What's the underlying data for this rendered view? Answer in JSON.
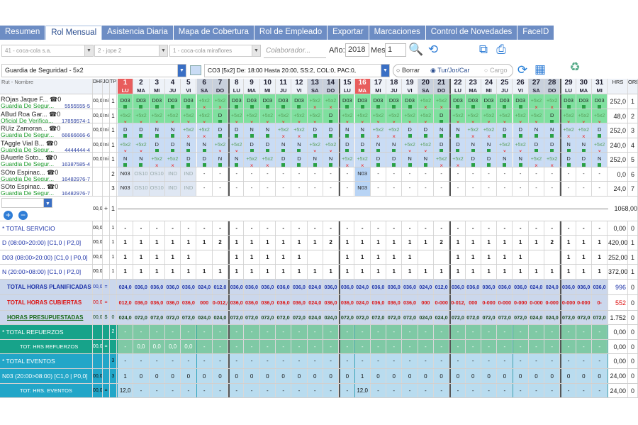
{
  "tabs": [
    "Resumen",
    "Rol Mensual",
    "Asistencia Diaria",
    "Mapa de Cobertura",
    "Rol de Empleado",
    "Exportar",
    "Marcaciones",
    "Control de Novedades",
    "FaceID"
  ],
  "active_tab": 1,
  "filters": {
    "company": "41 - coca-cola s.a.",
    "boss": "2 - jope 2",
    "branch": "1 - coca-cola miraflores",
    "collaborator_placeholder": "Colaborador...",
    "year_label": "Año:",
    "year": "2018",
    "month_label": "Mes:",
    "month": "1"
  },
  "service": {
    "name": "Guardia de Seguridad - 5x2",
    "code_text": "CO3    [5x2] De: 18:00 Hasta 20:00, SS:2, COL:0, PAC:0,",
    "radio_borrar": "Borrar",
    "radio_tur": "Tur/Jor/Car",
    "radio_cargo": "Cargo"
  },
  "colors": {
    "accent": "#6d8dc4",
    "red_day": "#e85d5d",
    "green_row": "#7fe09f",
    "blue_row": "#c9dcf5",
    "teal": "#17a38a",
    "cyan": "#22a6c8"
  },
  "header": {
    "rut_label": "Rut - Nombre",
    "dhp": "DHP",
    "jo": "JO",
    "tp": "TP",
    "hrs": "HRS",
    "ord": "ORD"
  },
  "days": [
    {
      "n": "1",
      "d": "LU"
    },
    {
      "n": "2",
      "d": "MA"
    },
    {
      "n": "3",
      "d": "MI"
    },
    {
      "n": "4",
      "d": "JU"
    },
    {
      "n": "5",
      "d": "VI"
    },
    {
      "n": "6",
      "d": "SA"
    },
    {
      "n": "7",
      "d": "DO"
    },
    {
      "n": "8",
      "d": "LU"
    },
    {
      "n": "9",
      "d": "MA"
    },
    {
      "n": "10",
      "d": "MI"
    },
    {
      "n": "11",
      "d": "JU"
    },
    {
      "n": "12",
      "d": "VI"
    },
    {
      "n": "13",
      "d": "SA"
    },
    {
      "n": "14",
      "d": "DO"
    },
    {
      "n": "15",
      "d": "LU"
    },
    {
      "n": "16",
      "d": "MA"
    },
    {
      "n": "17",
      "d": "MI"
    },
    {
      "n": "18",
      "d": "JU"
    },
    {
      "n": "19",
      "d": "VI"
    },
    {
      "n": "20",
      "d": "SA"
    },
    {
      "n": "21",
      "d": "DO"
    },
    {
      "n": "22",
      "d": "LU"
    },
    {
      "n": "23",
      "d": "MA"
    },
    {
      "n": "24",
      "d": "MI"
    },
    {
      "n": "25",
      "d": "JU"
    },
    {
      "n": "26",
      "d": "VI"
    },
    {
      "n": "27",
      "d": "SA"
    },
    {
      "n": "28",
      "d": "DO"
    },
    {
      "n": "29",
      "d": "LU"
    },
    {
      "n": "30",
      "d": "MA"
    },
    {
      "n": "31",
      "d": "MI"
    }
  ],
  "employees": [
    {
      "name": "ROjas Jaque F...",
      "role": "Guardia De Segur...",
      "rut": "5555555-5",
      "dhp": "00,0",
      "jo": "Ini",
      "tp": "1",
      "hrs": "252,0",
      "ord": "1",
      "color": "green",
      "cells": [
        "D03",
        "D03",
        "D03",
        "D03",
        "D03",
        "+5x2",
        "+5x2",
        "D03",
        "D03",
        "D03",
        "D03",
        "D03",
        "+5x2",
        "+5x2",
        "D03",
        "D03",
        "D03",
        "D03",
        "D03",
        "+5x2",
        "+5x2",
        "D03",
        "D03",
        "D03",
        "D03",
        "D03",
        "+5x2",
        "+5x2",
        "D03",
        "D03",
        "D03"
      ]
    },
    {
      "name": "ABud Roa Gar...",
      "role": "Oficial De Verifica...",
      "rut": "17859574-1",
      "dhp": "00,0",
      "jo": "Ini",
      "tp": "1",
      "hrs": "48,0",
      "ord": "2",
      "color": "green",
      "cells": [
        "+5x2",
        "+5x2",
        "+5x2",
        "+5x2",
        "+5x2",
        "+5x2",
        "D",
        "+5x2",
        "+5x2",
        "+5x2",
        "+5x2",
        "+5x2",
        "+5x2",
        "D",
        "+5x2",
        "+5x2",
        "+5x2",
        "+5x2",
        "+5x2",
        "+5x2",
        "D",
        "+5x2",
        "+5x2",
        "+5x2",
        "+5x2",
        "+5x2",
        "+5x2",
        "D",
        "+5x2",
        "+5x2",
        "+5x2"
      ]
    },
    {
      "name": "RUiz Zamoran...",
      "role": "Guardia De Segur...",
      "rut": "66666666-6",
      "dhp": "00,0",
      "jo": "Ini",
      "tp": "1",
      "hrs": "252,0",
      "ord": "3",
      "color": "blue",
      "cells": [
        "D",
        "D",
        "N",
        "N",
        "+5x2",
        "+5x2",
        "D",
        "D",
        "N",
        "N",
        "+5x2",
        "+5x2",
        "D",
        "D",
        "N",
        "N",
        "+5x2",
        "+5x2",
        "D",
        "D",
        "N",
        "N",
        "+5x2",
        "+5x2",
        "D",
        "D",
        "N",
        "N",
        "+5x2",
        "+5x2",
        "D"
      ]
    },
    {
      "name": "TAggle Vial B...",
      "role": "Guardia De Segur...",
      "rut": "4444444-4",
      "dhp": "00,0",
      "jo": "Ini",
      "tp": "1",
      "hrs": "240,0",
      "ord": "4",
      "color": "blue",
      "cells": [
        "+5x2",
        "+5x2",
        "D",
        "D",
        "N",
        "N",
        "+5x2",
        "+5x2",
        "D",
        "D",
        "N",
        "N",
        "+5x2",
        "+5x2",
        "D",
        "D",
        "N",
        "N",
        "+5x2",
        "+5x2",
        "D",
        "D",
        "N",
        "N",
        "+5x2",
        "+5x2",
        "D",
        "D",
        "N",
        "N",
        "+5x2"
      ]
    },
    {
      "name": "BAuerle Soto...",
      "role": "Guardia De Segur...",
      "rut": "16387585-4",
      "dhp": "00,0",
      "jo": "Ini",
      "tp": "1",
      "hrs": "252,0",
      "ord": "5",
      "color": "blue",
      "cells": [
        "N",
        "N",
        "+5x2",
        "+5x2",
        "D",
        "D",
        "N",
        "N",
        "+5x2",
        "+5x2",
        "D",
        "D",
        "N",
        "N",
        "+5x2",
        "+5x2",
        "D",
        "D",
        "N",
        "N",
        "+5x2",
        "+5x2",
        "D",
        "D",
        "N",
        "N",
        "+5x2",
        "+5x2",
        "D",
        "D",
        "N"
      ]
    },
    {
      "name": "SOto Espinac...",
      "role": "Guardia De Segur...",
      "rut": "16482976-7",
      "dhp": "",
      "jo": "",
      "tp": "2",
      "hrs": "0,0",
      "ord": "6",
      "color": "white",
      "cells": [
        "N03",
        "OS10",
        "OS10",
        "IND",
        "IND",
        "-",
        "-",
        "-",
        "-",
        "-",
        "-",
        "-",
        "-",
        "-",
        "-",
        "N03",
        "-",
        "-",
        "-",
        "-",
        "-",
        "-",
        "-",
        "-",
        "-",
        "-",
        "-",
        "-",
        "-",
        "-",
        "-"
      ]
    },
    {
      "name": "SOto Espinac...",
      "role": "Guardia De Segur...",
      "rut": "16482976-7",
      "dhp": "",
      "jo": "",
      "tp": "3",
      "hrs": "24,0",
      "ord": "7",
      "color": "white",
      "cells": [
        "N03",
        "OS10",
        "OS10",
        "IND",
        "IND",
        "-",
        "-",
        "-",
        "-",
        "-",
        "-",
        "-",
        "-",
        "-",
        "-",
        "N03",
        "-",
        "-",
        "-",
        "-",
        "-",
        "-",
        "-",
        "-",
        "-",
        "-",
        "-",
        "-",
        "-",
        "-",
        "-"
      ]
    }
  ],
  "blank_row": {
    "dhp": "00,0",
    "jo": "+",
    "tp": "1",
    "hrs": "1068,00",
    "ord": "0"
  },
  "summary": [
    {
      "label": "* TOTAL SERVICIO",
      "dhp": "00,0",
      "jo": "",
      "tp": "1",
      "vals": "-",
      "hrs": "0,00",
      "ord": "0",
      "style": "plain"
    },
    {
      "label": "D (08:00>20:00) [C1,0 | P2,0]",
      "dhp": "00,0",
      "jo": "",
      "tp": "1",
      "vals": [
        "1",
        "1",
        "1",
        "1",
        "1",
        "1",
        "2",
        "1",
        "1",
        "1",
        "1",
        "1",
        "1",
        "2",
        "1",
        "1",
        "1",
        "1",
        "1",
        "1",
        "2",
        "1",
        "1",
        "1",
        "1",
        "1",
        "1",
        "2",
        "1",
        "1",
        "1"
      ],
      "hrs": "420,00",
      "ord": "1",
      "style": "plain"
    },
    {
      "label": "D03 (08:00>20:00) [C1,0 | P0,0]",
      "dhp": "00,0",
      "jo": "",
      "tp": "1",
      "vals": [
        "1",
        "1",
        "1",
        "1",
        "1",
        "",
        "",
        "1",
        "1",
        "1",
        "1",
        "1",
        "",
        "",
        "1",
        "1",
        "1",
        "1",
        "1",
        "",
        "",
        "1",
        "1",
        "1",
        "1",
        "1",
        "",
        "",
        "1",
        "1",
        "1"
      ],
      "hrs": "252,00",
      "ord": "1",
      "style": "plain"
    },
    {
      "label": "N (20:00>08:00) [C1,0 | P2,0]",
      "dhp": "00,0",
      "jo": "",
      "tp": "1",
      "vals": [
        "1",
        "1",
        "1",
        "1",
        "1",
        "1",
        "1",
        "1",
        "1",
        "1",
        "1",
        "1",
        "1",
        "1",
        "1",
        "1",
        "1",
        "1",
        "1",
        "1",
        "1",
        "1",
        "1",
        "1",
        "1",
        "1",
        "1",
        "1",
        "1",
        "1",
        "1"
      ],
      "hrs": "372,00",
      "ord": "1",
      "style": "plain"
    },
    {
      "label": "TOTAL HORAS PLANIFICADAS",
      "dhp": "00,0",
      "jo": "=",
      "tp": "",
      "vals": [
        "024,0",
        "036,0",
        "036,0",
        "036,0",
        "036,0",
        "024,0",
        "012,0",
        "036,0",
        "036,0",
        "036,0",
        "036,0",
        "036,0",
        "024,0",
        "036,0",
        "036,0",
        "024,0",
        "036,0",
        "036,0",
        "036,0",
        "024,0",
        "012,0",
        "036,0",
        "036,0",
        "036,0",
        "036,0",
        "036,0",
        "024,0",
        "024,0",
        "036,0",
        "036,0",
        "036,0"
      ],
      "hrs": "996",
      "ord": "0",
      "style": "blue"
    },
    {
      "label": "TOTAL HORAS CUBIERTAS",
      "dhp": "00,0",
      "jo": "=",
      "tp": "",
      "vals": [
        "012,0",
        "036,0",
        "036,0",
        "036,0",
        "036,0",
        "000",
        "0-012,0",
        "036,0",
        "036,0",
        "036,0",
        "036,0",
        "036,0",
        "024,0",
        "036,0",
        "036,0",
        "024,0",
        "036,0",
        "036,0",
        "036,0",
        "000",
        "0-000",
        "0-012,0",
        "000",
        "0-000",
        "0-000",
        "0-000",
        "0-000",
        "0-000",
        "0-000",
        "0-000",
        "0-"
      ],
      "hrs": "552",
      "ord": "0",
      "style": "red"
    },
    {
      "label": "HORAS PRESUPUESTADAS",
      "dhp": "00,0",
      "jo": "$",
      "tp": "0",
      "vals": [
        "024,0",
        "072,0",
        "072,0",
        "072,0",
        "072,0",
        "024,0",
        "024,0",
        "072,0",
        "072,0",
        "072,0",
        "072,0",
        "072,0",
        "024,0",
        "024,0",
        "072,0",
        "072,0",
        "072,0",
        "072,0",
        "072,0",
        "024,0",
        "024,0",
        "072,0",
        "072,0",
        "072,0",
        "072,0",
        "072,0",
        "024,0",
        "024,0",
        "072,0",
        "072,0",
        "072,0"
      ],
      "hrs": "1.752",
      "ord": "0",
      "style": "green"
    },
    {
      "label": "* TOTAL REFUERZOS",
      "dhp": "",
      "jo": "",
      "tp": "2",
      "vals": "-",
      "hrs": "0,00",
      "ord": "0",
      "style": "teal"
    },
    {
      "label": "TOT. HRS REFUERZOS",
      "dhp": "00,0",
      "jo": "=",
      "tp": "",
      "vals": [
        "-",
        "0,0",
        "0,0",
        "0,0",
        "0,0",
        "-",
        "-",
        "-",
        "-",
        "-",
        "-",
        "-",
        "-",
        "-",
        "-",
        "-",
        "-",
        "-",
        "-",
        "-",
        "-",
        "-",
        "-",
        "-",
        "-",
        "-",
        "-",
        "-",
        "-",
        "-",
        "-"
      ],
      "hrs": "0,00",
      "ord": "0",
      "style": "teal"
    },
    {
      "label": "* TOTAL EVENTOS",
      "dhp": "",
      "jo": "",
      "tp": "3",
      "vals": "-",
      "hrs": "0,00",
      "ord": "0",
      "style": "cyan"
    },
    {
      "label": "N03 (20:00>08:00) [C1,0 | P0,0]",
      "dhp": "00,0",
      "jo": "",
      "tp": "3",
      "vals": [
        "1",
        "0",
        "0",
        "0",
        "0",
        "0",
        "0",
        "0",
        "0",
        "0",
        "0",
        "0",
        "0",
        "0",
        "0",
        "1",
        "0",
        "0",
        "0",
        "0",
        "0",
        "0",
        "0",
        "0",
        "0",
        "0",
        "0",
        "0",
        "0",
        "0",
        "0"
      ],
      "hrs": "24,00",
      "ord": "0",
      "style": "cyan"
    },
    {
      "label": "TOT. HRS. EVENTOS",
      "dhp": "00,0",
      "jo": "=",
      "tp": "",
      "vals": [
        "12,0",
        "-",
        "-",
        "-",
        "-",
        "-",
        "-",
        "-",
        "-",
        "-",
        "-",
        "-",
        "-",
        "-",
        "-",
        "12,0",
        "-",
        "-",
        "-",
        "-",
        "-",
        "-",
        "-",
        "-",
        "-",
        "-",
        "-",
        "-",
        "-",
        "-",
        "-"
      ],
      "hrs": "24,00",
      "ord": "0",
      "style": "cyan"
    }
  ]
}
